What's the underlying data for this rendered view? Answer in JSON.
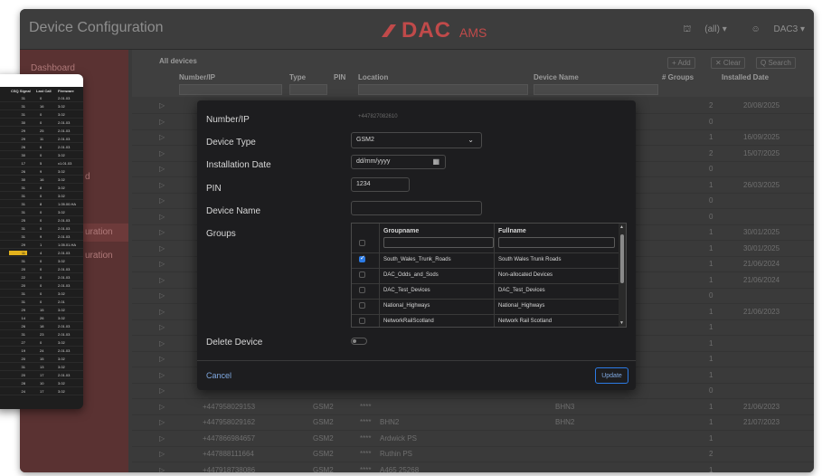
{
  "app": {
    "title": "Device Configuration",
    "logo_main": "DAC",
    "logo_sub": "AMS",
    "brand_color": "#c04a4a"
  },
  "user_menu": {
    "scope": "(all) ▾",
    "user": "DAC3 ▾"
  },
  "sidebar": {
    "items": [
      {
        "label": "Dashboard"
      },
      {
        "label": "d"
      },
      {
        "label": "uration"
      },
      {
        "label": "uration"
      }
    ]
  },
  "grid": {
    "title": "All devices",
    "toolbar": {
      "add": "+ Add",
      "clear": "✕ Clear",
      "search": "Q Search"
    },
    "columns": [
      "Number/IP",
      "Type",
      "PIN",
      "Location",
      "Device Name",
      "# Groups",
      "Installed Date"
    ],
    "rows": [
      {
        "groups": "2",
        "date": "20/08/2025"
      },
      {
        "groups": "0",
        "date": ""
      },
      {
        "groups": "1",
        "date": "16/09/2025"
      },
      {
        "groups": "2",
        "date": "15/07/2025"
      },
      {
        "groups": "0",
        "date": ""
      },
      {
        "groups": "1",
        "date": "26/03/2025"
      },
      {
        "groups": "0",
        "date": ""
      },
      {
        "groups": "0",
        "date": ""
      },
      {
        "groups": "1",
        "date": "30/01/2025"
      },
      {
        "groups": "1",
        "date": "30/01/2025"
      },
      {
        "groups": "1",
        "date": "21/06/2024"
      },
      {
        "groups": "1",
        "date": "21/06/2024"
      },
      {
        "groups": "0",
        "date": ""
      },
      {
        "groups": "1",
        "date": "21/06/2023"
      },
      {
        "groups": "1",
        "date": ""
      },
      {
        "groups": "1",
        "date": ""
      },
      {
        "groups": "1",
        "date": ""
      },
      {
        "groups": "1",
        "date": ""
      },
      {
        "groups": "0",
        "date": ""
      },
      {
        "number": "+447958029153",
        "type": "GSM2",
        "pin": "****",
        "location": "",
        "name": "BHN3",
        "groups": "1",
        "date": "21/06/2023"
      },
      {
        "number": "+447958029162",
        "type": "GSM2",
        "pin": "****",
        "location": "BHN2",
        "name": "BHN2",
        "groups": "1",
        "date": "21/07/2023"
      },
      {
        "number": "+447866984657",
        "type": "GSM2",
        "pin": "****",
        "location": "Ardwick PS",
        "name": "",
        "groups": "1",
        "date": ""
      },
      {
        "number": "+447888111664",
        "type": "GSM2",
        "pin": "****",
        "location": "Ruthin PS",
        "name": "",
        "groups": "2",
        "date": ""
      },
      {
        "number": "+447918738086",
        "type": "GSM2",
        "pin": "****",
        "location": "A465 25268",
        "name": "",
        "groups": "1",
        "date": ""
      },
      {
        "number": "+447932525246",
        "type": "GSM2",
        "pin": "****",
        "location": "A465 24328",
        "name": "",
        "groups": "0",
        "date": ""
      }
    ]
  },
  "sheet": {
    "headers": [
      "CSQ Signal",
      "Last Call",
      "Firmware"
    ],
    "rows": [
      [
        "31",
        "0",
        "2.01.03"
      ],
      [
        "31",
        "16",
        "3.02"
      ],
      [
        "31",
        "0",
        "3.02"
      ],
      [
        "30",
        "0",
        "2.01.03"
      ],
      [
        "29",
        "25",
        "2.01.03"
      ],
      [
        "29",
        "11",
        "2.01.03"
      ],
      [
        "26",
        "6",
        "2.01.03"
      ],
      [
        "30",
        "0",
        "3.02"
      ],
      [
        "17",
        "5",
        "x1.01.03"
      ],
      [
        "26",
        "9",
        "3.02"
      ],
      [
        "30",
        "16",
        "3.02"
      ],
      [
        "31",
        "8",
        "3.02"
      ],
      [
        "31",
        "0",
        "3.02"
      ],
      [
        "31",
        "8",
        "1.05.00.HA"
      ],
      [
        "31",
        "0",
        "3.02"
      ],
      [
        "25",
        "0",
        "2.01.03"
      ],
      [
        "31",
        "0",
        "2.01.03"
      ],
      [
        "31",
        "9",
        "2.01.03"
      ],
      [
        "29",
        "1",
        "1.05.01.HA"
      ],
      [
        "11",
        "4",
        "2.01.03"
      ],
      [
        "31",
        "0",
        "3.02"
      ],
      [
        "20",
        "0",
        "2.01.03"
      ],
      [
        "22",
        "0",
        "2.01.03"
      ],
      [
        "20",
        "0",
        "2.01.03"
      ],
      [
        "31",
        "0",
        "3.02"
      ],
      [
        "31",
        "0",
        "2.01"
      ],
      [
        "29",
        "15",
        "3.02"
      ],
      [
        "14",
        "26",
        "3.02"
      ],
      [
        "26",
        "18",
        "2.01.03"
      ],
      [
        "31",
        "23",
        "2.01.03"
      ],
      [
        "27",
        "0",
        "3.02"
      ],
      [
        "19",
        "24",
        "2.01.03"
      ],
      [
        "20",
        "15",
        "3.02"
      ],
      [
        "31",
        "13",
        "3.02"
      ],
      [
        "20",
        "17",
        "2.01.03"
      ],
      [
        "28",
        "10",
        "3.02"
      ],
      [
        "24",
        "17",
        "3.02"
      ]
    ],
    "highlight_row": 19,
    "highlight_color": "#e3b21c"
  },
  "modal": {
    "labels": {
      "number": "Number/IP",
      "type": "Device Type",
      "date": "Installation Date",
      "pin": "PIN",
      "name": "Device Name",
      "groups": "Groups",
      "delete": "Delete Device"
    },
    "number_value": "+447827082610",
    "type_value": "GSM2",
    "date_placeholder": "dd/mm/yyyy",
    "pin_value": "1234",
    "name_value": "",
    "groups_table": {
      "headers": [
        "Groupname",
        "Fullname"
      ],
      "rows": [
        {
          "checked": true,
          "groupname": "South_Wales_Trunk_Roads",
          "fullname": "South Wales Trunk Roads"
        },
        {
          "checked": false,
          "groupname": "DAC_Odds_and_Sods",
          "fullname": "Non-allocated Devices"
        },
        {
          "checked": false,
          "groupname": "DAC_Test_Devices",
          "fullname": "DAC_Test_Devices"
        },
        {
          "checked": false,
          "groupname": "National_Highways",
          "fullname": "National_Highways"
        },
        {
          "checked": false,
          "groupname": "NetworkRailScotland",
          "fullname": "Network Rail Scotland"
        }
      ]
    },
    "delete_toggle": false,
    "cancel": "Cancel",
    "update": "Update",
    "accent": "#2c7be5"
  }
}
